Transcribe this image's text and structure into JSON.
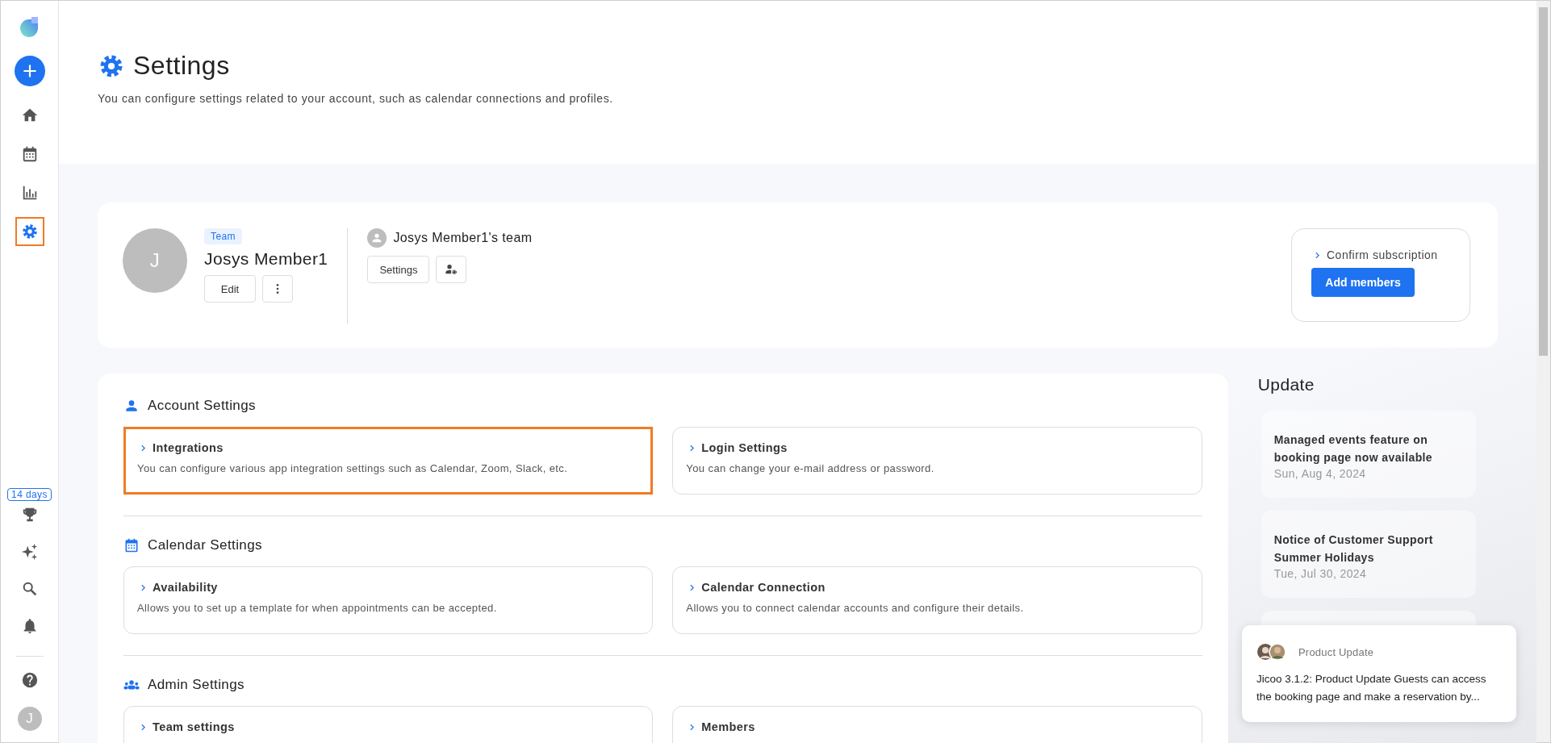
{
  "sidebar": {
    "nav": [
      {
        "kind": "home",
        "selected": false,
        "highlighted": false
      },
      {
        "kind": "calendar",
        "selected": false,
        "highlighted": false
      },
      {
        "kind": "chart",
        "selected": false,
        "highlighted": false
      },
      {
        "kind": "settings",
        "selected": true,
        "highlighted": true
      }
    ],
    "trial_badge": "14 days",
    "tools": [
      {
        "kind": "trophy"
      },
      {
        "kind": "sparkles"
      },
      {
        "kind": "search"
      },
      {
        "kind": "bell"
      }
    ],
    "help": {
      "kind": "help"
    },
    "avatar": "J"
  },
  "header": {
    "title": "Settings",
    "subtitle": "You can configure settings related to your account, such as calendar connections and profiles."
  },
  "profile": {
    "avatar": "J",
    "badge": "Team",
    "name": "Josys Member1",
    "edit_button": "Edit",
    "team": {
      "name": "Josys Member1's team",
      "settings_button": "Settings"
    },
    "subscription": {
      "link": "Confirm subscription",
      "button": "Add members"
    }
  },
  "sections": [
    {
      "kind": "account",
      "title": "Account Settings",
      "items": [
        {
          "title": "Integrations",
          "description": "You can configure various app integration settings such as Calendar, Zoom, Slack, etc.",
          "highlighted": true
        },
        {
          "title": "Login Settings",
          "description": "You can change your e-mail address or password.",
          "highlighted": false
        }
      ]
    },
    {
      "kind": "calendar",
      "title": "Calendar Settings",
      "items": [
        {
          "title": "Availability",
          "description": "Allows you to set up a template for when appointments can be accepted.",
          "highlighted": false
        },
        {
          "title": "Calendar Connection",
          "description": "Allows you to connect calendar accounts and configure their details.",
          "highlighted": false
        }
      ]
    },
    {
      "kind": "admin",
      "title": "Admin Settings",
      "items": [
        {
          "title": "Team settings",
          "highlighted": false
        },
        {
          "title": "Members",
          "highlighted": false
        }
      ]
    }
  ],
  "updates": {
    "title": "Update",
    "items": [
      {
        "title": "Managed events feature on booking page now available",
        "date": "Sun, Aug 4, 2024"
      },
      {
        "title": "Notice of Customer Support Summer Holidays",
        "date": "Tue, Jul 30, 2024"
      }
    ]
  },
  "toast": {
    "label": "Product Update",
    "text": "Jicoo 3.1.2: Product Update Guests can access the booking page and make a reservation by..."
  }
}
